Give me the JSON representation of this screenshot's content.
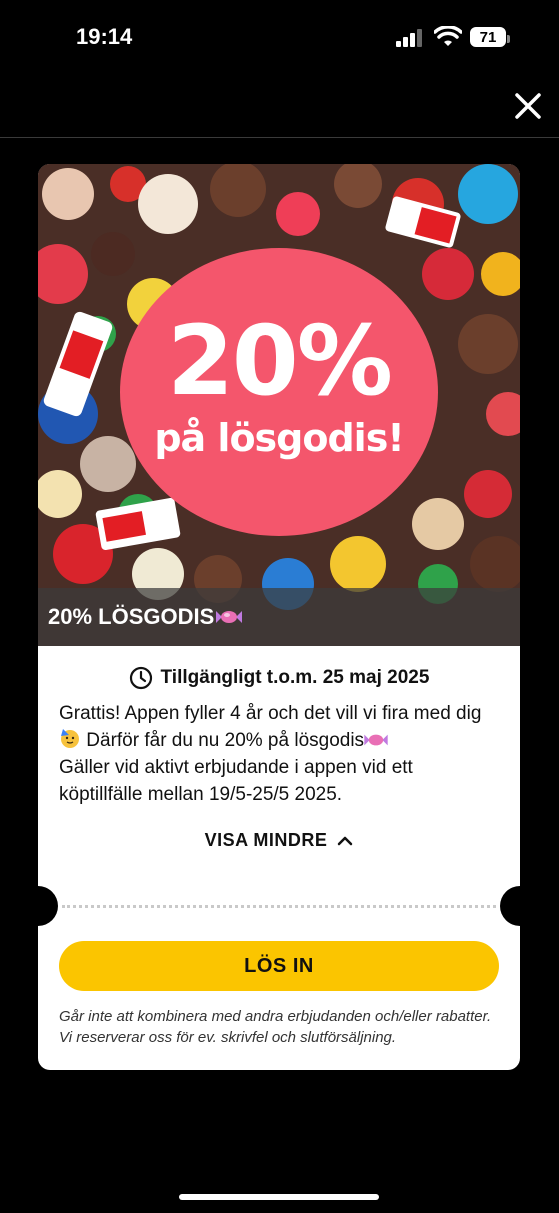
{
  "status_bar": {
    "time": "19:14",
    "battery_level": "71",
    "icons": [
      "signal-icon",
      "wifi-icon",
      "battery-icon"
    ]
  },
  "header": {
    "close_icon": "close-icon"
  },
  "offer": {
    "image": {
      "percent": "20%",
      "headline": "på lösgodis!",
      "circle_color": "#f4566c"
    },
    "caption": "20% LÖSGODIS",
    "availability": "Tillgängligt t.o.m. 25 maj 2025",
    "description": {
      "line1": "Grattis! Appen fyller 4 år och det vill vi fira med dig",
      "line2": " Därför får du nu 20% på lösgodis",
      "line3": "Gäller vid aktivt erbjudande i appen vid ett köptillfälle mellan 19/5-25/5 2025."
    },
    "toggle_label": "VISA MINDRE",
    "redeem_label": "LÖS IN",
    "redeem_color": "#fbc500",
    "disclaimer": "Går inte att kombinera med andra erbjudanden och/eller rabatter. Vi reserverar oss för ev. skrivfel och slutförsäljning."
  }
}
